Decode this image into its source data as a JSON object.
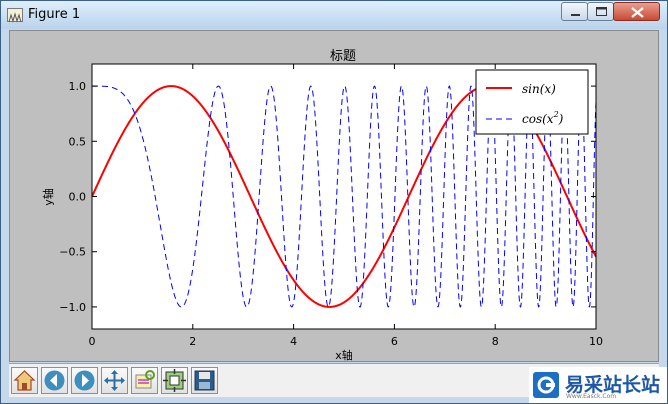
{
  "window": {
    "title": "Figure 1"
  },
  "chart_data": {
    "type": "line",
    "title": "标题",
    "xlabel": "x轴",
    "ylabel": "y轴",
    "xlim": [
      0,
      10
    ],
    "ylim": [
      -1.2,
      1.2
    ],
    "x_ticks": [
      0,
      2,
      4,
      6,
      8,
      10
    ],
    "y_ticks": [
      -1.0,
      -0.5,
      0.0,
      0.5,
      1.0
    ],
    "x_tick_labels": [
      "0",
      "2",
      "4",
      "6",
      "8",
      "10"
    ],
    "y_tick_labels": [
      "−1.0",
      "−0.5",
      "0.0",
      "0.5",
      "1.0"
    ],
    "grid": false,
    "legend_position": "upper right",
    "series": [
      {
        "name": "sin(x)",
        "legend_base": "sin(x)",
        "function": "sin",
        "color": "#ff0000",
        "style": "solid",
        "width": 2
      },
      {
        "name": "cos(x2)",
        "legend_base": "cos(x",
        "legend_sup": "2",
        "legend_tail": ")",
        "function": "cos_x_squared",
        "color": "#0000ff",
        "style": "dashed",
        "width": 1
      }
    ]
  },
  "toolbar": {
    "buttons": [
      {
        "id": "home",
        "icon": "home-icon"
      },
      {
        "id": "back",
        "icon": "back-arrow-icon"
      },
      {
        "id": "forward",
        "icon": "forward-arrow-icon"
      },
      {
        "id": "pan",
        "icon": "pan-icon"
      },
      {
        "id": "zoom",
        "icon": "zoom-rect-icon"
      },
      {
        "id": "subplots",
        "icon": "configure-subplots-icon"
      },
      {
        "id": "save",
        "icon": "save-icon"
      }
    ]
  },
  "watermark": {
    "text": "易采站长站",
    "subtext": "Www.Easck.Com"
  }
}
